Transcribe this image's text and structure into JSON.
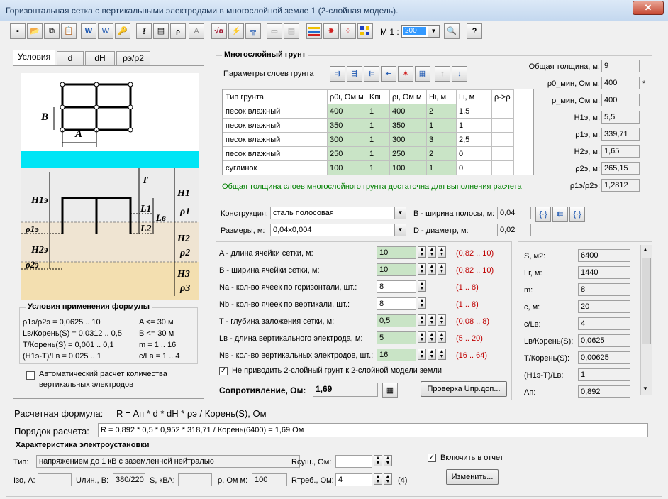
{
  "window": {
    "title": "Горизонтальная сетка с вертикальными электродами в многослойной земле 1 (2-слойная модель).",
    "close": "✕"
  },
  "toolbar": {
    "m1_label": "M 1 :",
    "m1_value": "200"
  },
  "tabs": [
    "Условия",
    "d",
    "dH",
    "ρэ/ρ2"
  ],
  "diagram": {
    "B": "B",
    "A": "A",
    "T": "T",
    "L1": "L1",
    "Lv": "Lв",
    "L2": "L2",
    "H1e": "H1э",
    "rho1e": "ρ1э",
    "H2e": "H2э",
    "rho2e": "ρ2э",
    "H1": "H1",
    "rho1": "ρ1",
    "H2": "H2",
    "rho2": "ρ2",
    "H3": "H3",
    "rho3": "ρ3"
  },
  "conditions": {
    "title": "Условия применения формулы",
    "rows": [
      [
        "ρ1э/ρ2э = 0,0625 .. 10",
        "A <= 30 м"
      ],
      [
        "Lв/Корень(S) = 0,0312 .. 0,5",
        "B <= 30 м"
      ],
      [
        "T/Корень(S) = 0,001 .. 0,1",
        "m = 1 .. 16"
      ],
      [
        "(H1э-T)/Lв = 0,025 .. 1",
        "c/Lв = 1 .. 4"
      ]
    ]
  },
  "auto_calc": {
    "label_1": "Автоматический расчет количества",
    "label_2": "вертикальных электродов"
  },
  "soil": {
    "title": "Многослойный грунт",
    "params_label": "Параметры слоев грунта",
    "columns": [
      "Тип грунта",
      "ρ0i, Ом м",
      "Kпi",
      "ρi, Ом м",
      "Hi, м",
      "Li, м",
      "ρ->ρ"
    ],
    "rows": [
      [
        "песок влажный",
        "400",
        "1",
        "400",
        "2",
        "1,5",
        ""
      ],
      [
        "песок влажный",
        "350",
        "1",
        "350",
        "1",
        "1",
        ""
      ],
      [
        "песок влажный",
        "300",
        "1",
        "300",
        "3",
        "2,5",
        ""
      ],
      [
        "песок влажный",
        "250",
        "1",
        "250",
        "2",
        "0",
        ""
      ],
      [
        "суглинок",
        "100",
        "1",
        "100",
        "1",
        "0",
        ""
      ]
    ],
    "status": "Общая толщина слоев многослойного грунта достаточна для выполнения расчета"
  },
  "summary": [
    {
      "label": "Общая толщина, м:",
      "value": "9"
    },
    {
      "label": "ρ0_мин, Ом м:",
      "value": "400"
    },
    {
      "label": "ρ_мин, Ом м:",
      "value": "400"
    },
    {
      "label": "H1э, м:",
      "value": "5,5"
    },
    {
      "label": "ρ1э, м:",
      "value": "339,71"
    },
    {
      "label": "H2э, м:",
      "value": "1,65"
    },
    {
      "label": "ρ2э, м:",
      "value": "265,15"
    },
    {
      "label": "ρ1э/ρ2э:",
      "value": "1,2812"
    }
  ],
  "summary_star": "*",
  "construction": {
    "label": "Конструкция:",
    "value": "сталь полосовая",
    "size_label": "Размеры, м:",
    "size_value": "0,04x0,004",
    "b_label": "B - ширина полосы, м:",
    "b_value": "0,04",
    "d_label": "D - диаметр, м:",
    "d_value": "0,02"
  },
  "params": [
    {
      "label": "A - длина ячейки сетки, м:",
      "value": "10",
      "range": "(0,82 .. 10)",
      "green": true
    },
    {
      "label": "B - ширина ячейки сетки, м:",
      "value": "10",
      "range": "(0,82 .. 10)",
      "green": true
    },
    {
      "label": "Na - кол-во ячеек по горизонтали, шт.:",
      "value": "8",
      "range": "(1 .. 8)",
      "green": false
    },
    {
      "label": "Nb - кол-во ячеек по вертикали, шт.:",
      "value": "8",
      "range": "(1 .. 8)",
      "green": false
    },
    {
      "label": "T - глубина заложения сетки, м:",
      "value": "0,5",
      "range": "(0,08 .. 8)",
      "green": true
    },
    {
      "label": "Lв - длина вертикального электрода, м:",
      "value": "5",
      "range": "(5 .. 20)",
      "green": true
    },
    {
      "label": "Nв - кол-во вертикальных электродов, шт.:",
      "value": "16",
      "range": "(16 .. 64)",
      "green": true
    }
  ],
  "no_reduce": {
    "label": "Не приводить 2-слойный грунт к 2-слойной модели земли",
    "checked": "✓"
  },
  "resistance": {
    "label": "Сопротивление, Ом:",
    "value": "1,69",
    "check_button": "Проверка Uпр.доп..."
  },
  "results": [
    {
      "label": "S, м2:",
      "value": "6400"
    },
    {
      "label": "Lг, м:",
      "value": "1440"
    },
    {
      "label": "m:",
      "value": "8"
    },
    {
      "label": "c, м:",
      "value": "20"
    },
    {
      "label": "c/Lв:",
      "value": "4"
    },
    {
      "label": "Lв/Корень(S):",
      "value": "0,0625"
    },
    {
      "label": "T/Корень(S):",
      "value": "0,00625"
    },
    {
      "label": "(H1э-T)/Lв:",
      "value": "1"
    },
    {
      "label": "Aп:",
      "value": "0,892"
    }
  ],
  "formula": {
    "label": "Расчетная формула:",
    "text": "R = Aп * d * dH * ρэ / Корень(S), Ом"
  },
  "order": {
    "label": "Порядок расчета:",
    "text": "R = 0,892 * 0,5 * 0,952 * 318,71 / Корень(6400) = 1,69 Ом"
  },
  "install": {
    "title": "Характеристика электроустановки",
    "type_label": "Тип:",
    "type_value": "напряжением до 1 кВ с заземленной нейтралью",
    "rsush_label": "Rсущ., Ом:",
    "rsush_value": "",
    "include_label": "Включить в отчет",
    "include_checked": "✓",
    "iz_label": "Iзо, А:",
    "iz_value": "",
    "ulin_label": "Uлин., В:",
    "ulin_value": "380/220",
    "s_label": "S, кВА:",
    "s_value": "",
    "rho_label": "ρ, Ом м:",
    "rho_value": "100",
    "rtreb_label": "Rтреб., Ом:",
    "rtreb_value": "4",
    "rtreb_note": "(4)",
    "edit_button": "Изменить..."
  }
}
